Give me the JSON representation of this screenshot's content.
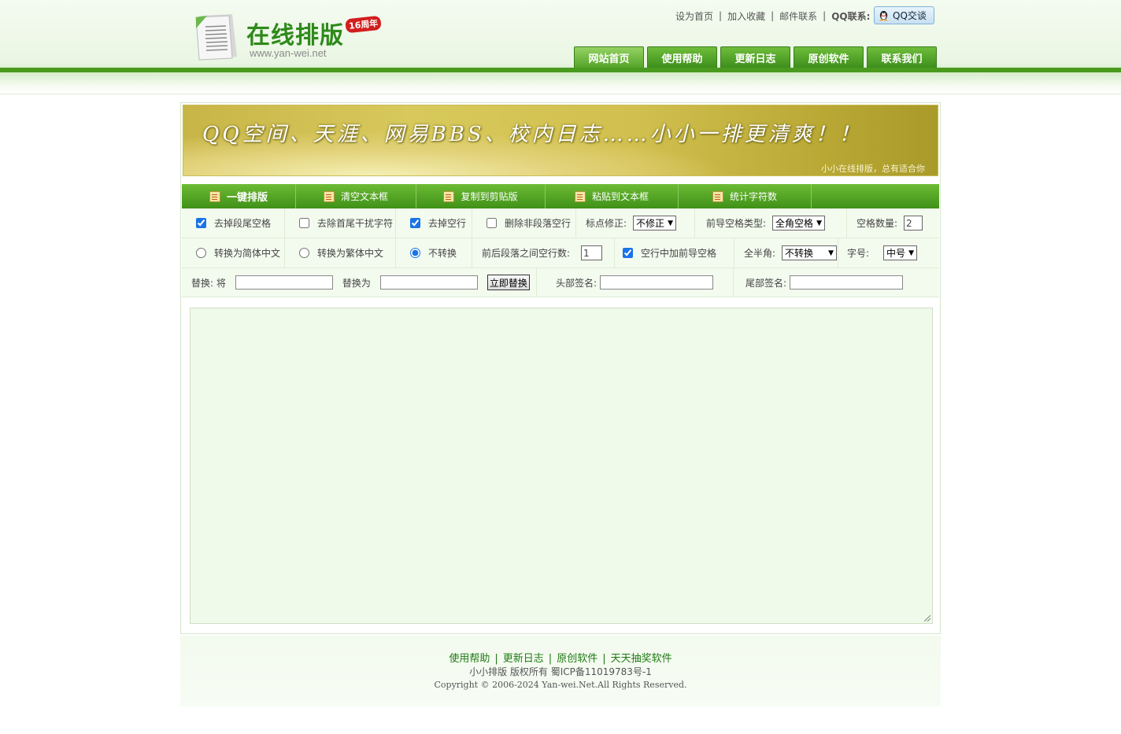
{
  "header": {
    "logo_title": "在线排版",
    "logo_badge": "16周年",
    "logo_url": "www.yan-wei.net",
    "top_links": [
      "设为首页",
      "加入收藏",
      "邮件联系"
    ],
    "qq_label": "QQ联系:",
    "qq_button": "QQ交谈",
    "nav": [
      "网站首页",
      "使用帮助",
      "更新日志",
      "原创软件",
      "联系我们"
    ]
  },
  "banner": {
    "text": "QQ空间、天涯、网易BBS、校内日志……小小一排更清爽！！",
    "sub": "小小在线排版，总有适合你"
  },
  "toolbar": [
    "一键排版",
    "清空文本框",
    "复制到剪贴版",
    "粘贴到文本框",
    "统计字符数"
  ],
  "row1": {
    "opt1": {
      "label": "去掉段尾空格",
      "checked": true
    },
    "opt2": {
      "label": "去除首尾干扰字符",
      "checked": false
    },
    "opt3": {
      "label": "去掉空行",
      "checked": true
    },
    "opt4": {
      "label": "删除非段落空行",
      "checked": false
    },
    "punct_label": "标点修正:",
    "punct_value": "不修正",
    "lead_label": "前导空格类型:",
    "lead_value": "全角空格",
    "count_label": "空格数量:",
    "count_value": "2"
  },
  "row2": {
    "radio1": "转换为简体中文",
    "radio2": "转换为繁体中文",
    "radio3": "不转换",
    "selected_radio": "不转换",
    "para_label": "前后段落之间空行数:",
    "para_value": "1",
    "empty_line_opt": {
      "label": "空行中加前导空格",
      "checked": true
    },
    "width_label": "全半角:",
    "width_value": "不转换",
    "size_label": "字号:",
    "size_value": "中号"
  },
  "row3": {
    "replace_label": "替换: 将",
    "replace_with_label": "替换为",
    "replace_button": "立即替换",
    "head_sign_label": "头部签名:",
    "tail_sign_label": "尾部签名:"
  },
  "footer": {
    "links": [
      "使用帮助",
      "更新日志",
      "原创软件",
      "天天抽奖软件"
    ],
    "copyright": "小小排版 版权所有 蜀ICP备11019783号-1",
    "copyright_en": "Copyright © 2006-2024 Yan-wei.Net.All Rights Reserved."
  }
}
